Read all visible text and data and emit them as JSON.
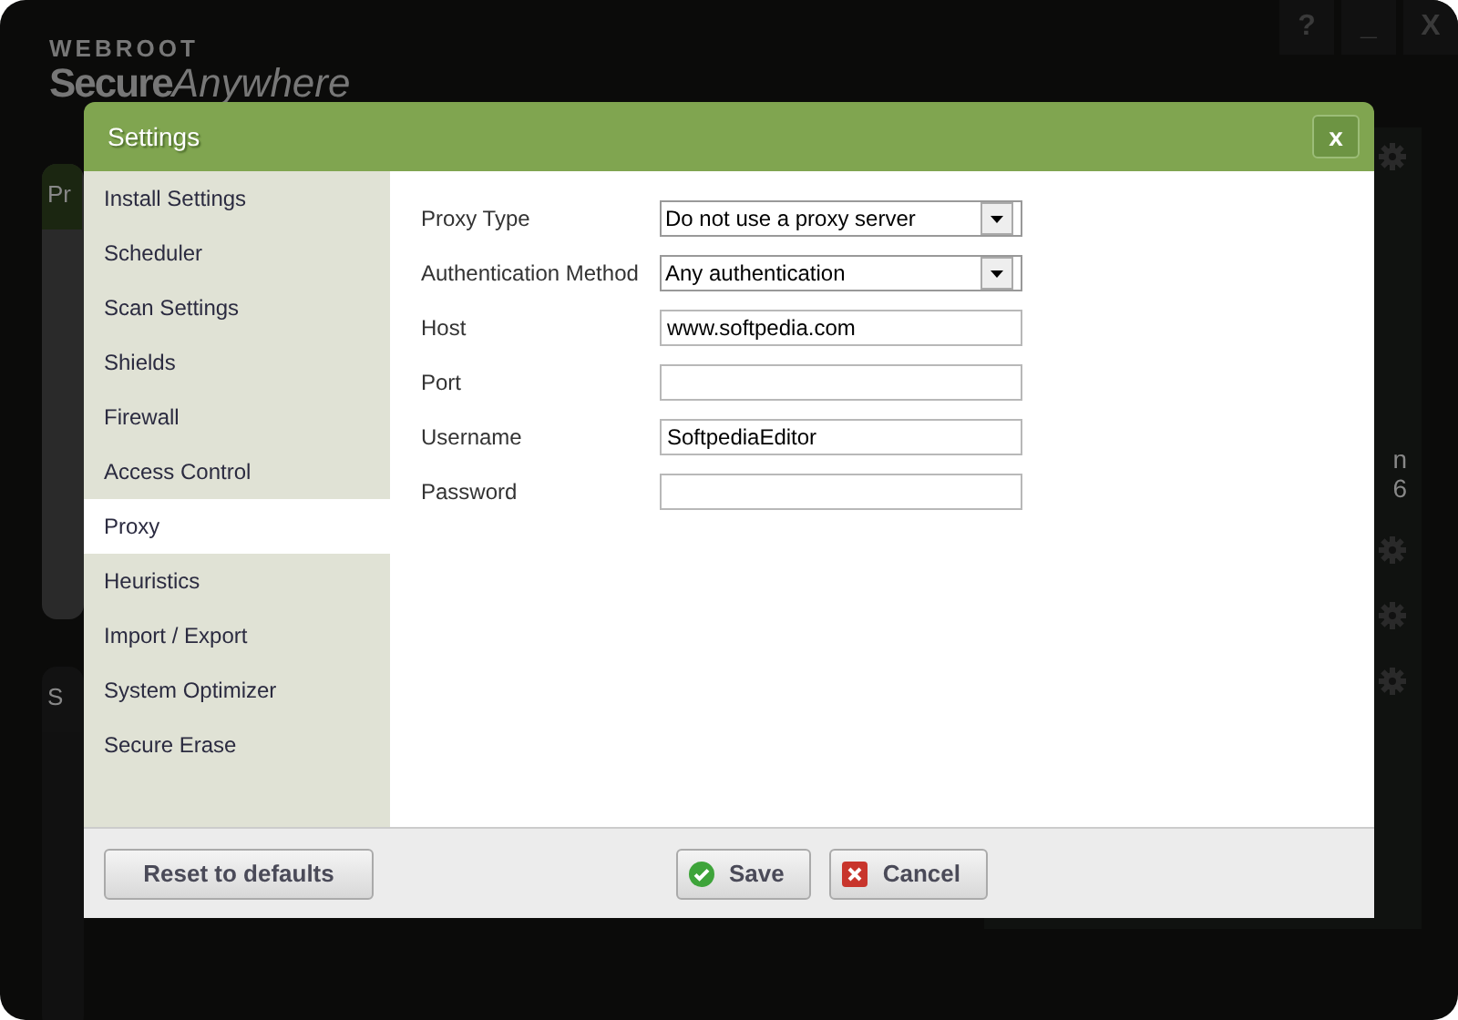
{
  "app": {
    "brand": "WEBROOT",
    "product_a": "Secure",
    "product_b": "Anywhere",
    "window_buttons": [
      "?",
      "_",
      "X"
    ],
    "panels": [
      {
        "title": "Pr"
      },
      {
        "title": "S"
      }
    ],
    "side_fragments": [
      "n",
      "6"
    ]
  },
  "dialog": {
    "title": "Settings",
    "close": "x",
    "nav": [
      {
        "label": "Install Settings",
        "selected": false
      },
      {
        "label": "Scheduler",
        "selected": false
      },
      {
        "label": "Scan Settings",
        "selected": false
      },
      {
        "label": "Shields",
        "selected": false
      },
      {
        "label": "Firewall",
        "selected": false
      },
      {
        "label": "Access Control",
        "selected": false
      },
      {
        "label": "Proxy",
        "selected": true
      },
      {
        "label": "Heuristics",
        "selected": false
      },
      {
        "label": "Import / Export",
        "selected": false
      },
      {
        "label": "System Optimizer",
        "selected": false
      },
      {
        "label": "Secure Erase",
        "selected": false
      }
    ],
    "fields": [
      {
        "label": "Proxy Type",
        "kind": "select",
        "value": "Do not use a proxy server"
      },
      {
        "label": "Authentication Method",
        "kind": "select",
        "value": "Any authentication"
      },
      {
        "label": "Host",
        "kind": "text",
        "value": "www.softpedia.com"
      },
      {
        "label": "Port",
        "kind": "text"
      },
      {
        "label": "Username",
        "kind": "text",
        "value": "SoftpediaEditor"
      },
      {
        "label": "Password",
        "kind": "text"
      }
    ],
    "buttons": [
      {
        "label": "Reset to defaults",
        "kind": "reset"
      },
      {
        "label": "Save",
        "kind": "save"
      },
      {
        "label": "Cancel",
        "kind": "cancel"
      }
    ]
  }
}
